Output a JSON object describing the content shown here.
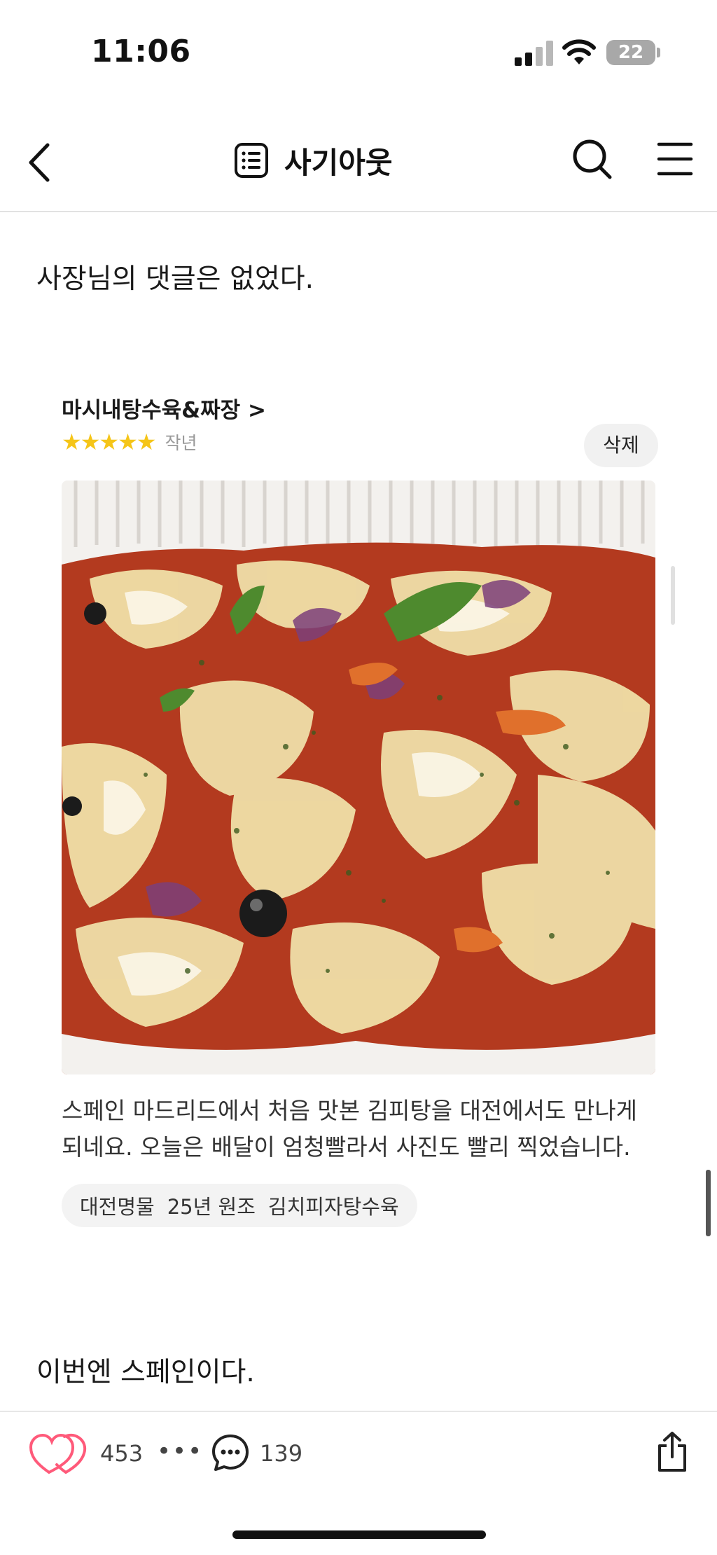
{
  "status_bar": {
    "time": "11:06",
    "battery": "22"
  },
  "nav": {
    "title": "사기아웃"
  },
  "post": {
    "line_before": "사장님의 댓글은 없었다.",
    "line_after": "이번엔 스페인이다."
  },
  "review": {
    "shop_name": "마시내탕수육&짜장 >",
    "stars": "★★★★★",
    "rating_value": 5,
    "date": "작년",
    "delete_label": "삭제",
    "text_lines": [
      "스페인 마드리드에서 처음 맛본 김피탕을 대전에서도 만나게",
      "되네요. 오늘은 배달이 엄청빨라서 사진도 빨리 찍었습니다."
    ],
    "tags": [
      "대전명물",
      "25년 원조",
      "김치피자탕수육"
    ],
    "photo_icon": "food-photo"
  },
  "bottom_bar": {
    "like_count": "453",
    "more": "•••",
    "comment_count": "139"
  },
  "colors": {
    "like": "#ff5a7a",
    "star": "#f5c518"
  }
}
